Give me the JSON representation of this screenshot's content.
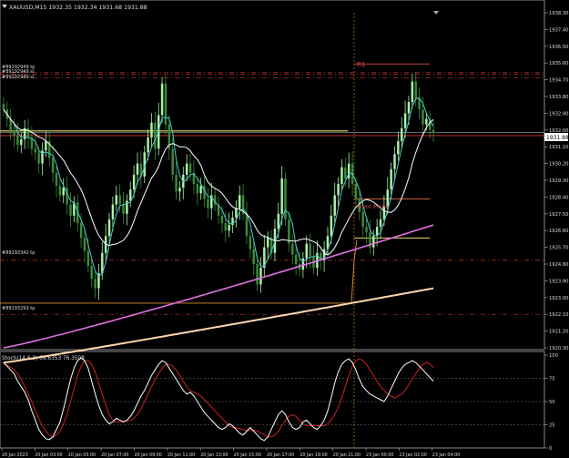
{
  "window": {
    "symbol_header": "XAUUSD,M15  1932.35 1932.34 1931.68 1931.88",
    "stoch_header": "Stoch(14,6,3) 69.6353 76.3508"
  },
  "price_axis": {
    "labels": [
      "1938.30",
      "1937.40",
      "1936.50",
      "1935.60",
      "1934.70",
      "1933.80",
      "1932.90",
      "1932.00",
      "1931.10",
      "1930.20",
      "1929.30",
      "1928.40",
      "1927.50",
      "1926.60",
      "1925.70",
      "1924.80",
      "1923.90",
      "1923.00",
      "1922.10",
      "1921.20",
      "1920.30"
    ],
    "current_price_tag": "1931.88",
    "ylim": [
      1920.3,
      1938.3
    ]
  },
  "stoch_axis": {
    "labels": [
      "100",
      "75",
      "50",
      "25",
      "0"
    ]
  },
  "time_axis": {
    "labels": [
      "20 Jan 2023",
      "20 Jan 03:00",
      "20 Jan 05:00",
      "20 Jan 07:00",
      "20 Jan 09:00",
      "20 Jan 11:00",
      "20 Jan 13:00",
      "20 Jan 15:00",
      "20 Jan 17:00",
      "20 Jan 19:00",
      "20 Jan 21:00",
      "23 Jan 00:00",
      "23 Jan 02:00",
      "23 Jan 04:00"
    ]
  },
  "annotations": {
    "order_lines": [
      "#89192949 tp",
      "#89192949 sl",
      "#89192949 sl",
      "#89193342 tp",
      "#89193293 tp"
    ],
    "pivot_labels": [
      "R1",
      "Pivot Point"
    ]
  },
  "colors": {
    "background": "#000000",
    "grid": "#2a2a2a",
    "bull_candle": "#aaf0a8",
    "bear_candle": "#3a8a3a",
    "ma_fast": "#4ec8c8",
    "ma_mid": "#ffffff",
    "ma_slow": "#e070e0",
    "ma_slowest": "#ffd8b0",
    "stoch_main": "#ffffff",
    "stoch_signal": "#cc2020",
    "pivot": "#e05050",
    "order_line": "#c83232",
    "highlight_yellow": "#e8e060",
    "orange_line": "#e09030"
  },
  "chart_data": {
    "type": "candlestick",
    "ylim": [
      1920.3,
      1938.3
    ],
    "candles_close": [
      1933.1,
      1932.6,
      1932.0,
      1931.7,
      1931.2,
      1931.5,
      1932.1,
      1931.6,
      1931.0,
      1930.8,
      1930.2,
      1930.9,
      1931.4,
      1930.5,
      1929.7,
      1929.0,
      1928.5,
      1928.9,
      1928.0,
      1927.4,
      1928.1,
      1927.0,
      1926.2,
      1925.5,
      1924.7,
      1924.0,
      1923.5,
      1924.3,
      1925.4,
      1926.3,
      1927.2,
      1928.0,
      1928.5,
      1928.0,
      1927.5,
      1928.2,
      1928.8,
      1929.6,
      1930.2,
      1929.5,
      1930.8,
      1931.6,
      1932.4,
      1931.0,
      1932.8,
      1934.5,
      1932.3,
      1931.0,
      1929.6,
      1928.7,
      1928.9,
      1929.6,
      1930.2,
      1929.7,
      1929.1,
      1928.6,
      1929.0,
      1928.3,
      1927.8,
      1928.5,
      1928.0,
      1927.4,
      1927.0,
      1926.6,
      1926.9,
      1927.3,
      1927.8,
      1928.5,
      1927.5,
      1926.3,
      1925.6,
      1924.8,
      1923.7,
      1924.6,
      1925.7,
      1926.2,
      1925.4,
      1926.7,
      1927.5,
      1929.4,
      1927.2,
      1925.9,
      1925.3,
      1924.8,
      1924.5,
      1925.1,
      1925.9,
      1925.2,
      1924.6,
      1925.4,
      1925.0,
      1925.6,
      1926.3,
      1927.4,
      1928.5,
      1929.1,
      1930.0,
      1929.4,
      1930.2,
      1929.1,
      1928.3,
      1927.6,
      1926.8,
      1926.5,
      1925.7,
      1926.3,
      1926.8,
      1927.2,
      1927.9,
      1928.8,
      1929.9,
      1930.7,
      1931.4,
      1932.1,
      1932.9,
      1933.5,
      1934.6,
      1933.7,
      1933.1,
      1932.3,
      1932.6,
      1932.0,
      1931.88
    ],
    "stoch_main": [
      92,
      88,
      84,
      80,
      72,
      66,
      60,
      52,
      40,
      30,
      20,
      14,
      10,
      9,
      12,
      20,
      28,
      42,
      58,
      74,
      86,
      94,
      97,
      94,
      86,
      72,
      58,
      46,
      36,
      30,
      26,
      28,
      32,
      30,
      28,
      30,
      34,
      40,
      48,
      56,
      62,
      70,
      78,
      84,
      90,
      94,
      92,
      86,
      80,
      74,
      68,
      62,
      58,
      60,
      56,
      50,
      44,
      38,
      34,
      30,
      26,
      22,
      20,
      22,
      26,
      24,
      20,
      16,
      14,
      18,
      22,
      18,
      14,
      10,
      8,
      12,
      20,
      28,
      36,
      40,
      36,
      28,
      22,
      20,
      22,
      28,
      30,
      26,
      22,
      20,
      24,
      30,
      40,
      54,
      70,
      82,
      90,
      94,
      96,
      92,
      84,
      74,
      66,
      62,
      58,
      56,
      54,
      52,
      50,
      56,
      64,
      72,
      80,
      86,
      90,
      92,
      94,
      92,
      88,
      84,
      80,
      76,
      72
    ],
    "stoch_signal": [
      90,
      89,
      87,
      84,
      80,
      74,
      66,
      58,
      50,
      40,
      32,
      24,
      18,
      14,
      12,
      14,
      18,
      26,
      36,
      50,
      64,
      78,
      88,
      94,
      94,
      90,
      82,
      70,
      58,
      46,
      36,
      30,
      28,
      28,
      29,
      29,
      30,
      32,
      36,
      42,
      50,
      58,
      66,
      74,
      80,
      86,
      90,
      90,
      88,
      84,
      78,
      72,
      66,
      62,
      60,
      58,
      56,
      52,
      48,
      44,
      40,
      36,
      32,
      28,
      24,
      22,
      22,
      21,
      20,
      19,
      19,
      19,
      18,
      16,
      14,
      12,
      12,
      14,
      18,
      24,
      30,
      34,
      36,
      34,
      30,
      26,
      24,
      24,
      24,
      24,
      24,
      24,
      26,
      30,
      36,
      44,
      54,
      66,
      78,
      88,
      94,
      96,
      94,
      90,
      84,
      78,
      72,
      66,
      62,
      58,
      56,
      54,
      56,
      58,
      62,
      68,
      74,
      80,
      86,
      90,
      92,
      91,
      86
    ],
    "series": [
      {
        "name": "",
        "line": "ma_fast"
      },
      {
        "name": "",
        "line": "ma_mid"
      },
      {
        "name": "",
        "line": "ma_slow"
      },
      {
        "name": "",
        "line": "ma_slowest"
      }
    ],
    "levels": {
      "order_tp_1": 1935.1,
      "order_sl_1": 1935.0,
      "order_sl_2": 1934.8,
      "yellow_line": 1931.95,
      "current_line": 1931.88,
      "red_h_line": 1931.7,
      "tp_2": 1925.0,
      "tp_3": 1922.1,
      "r1": 1935.55,
      "pivot_point": 1928.3,
      "pivot_lower": 1926.2
    }
  }
}
